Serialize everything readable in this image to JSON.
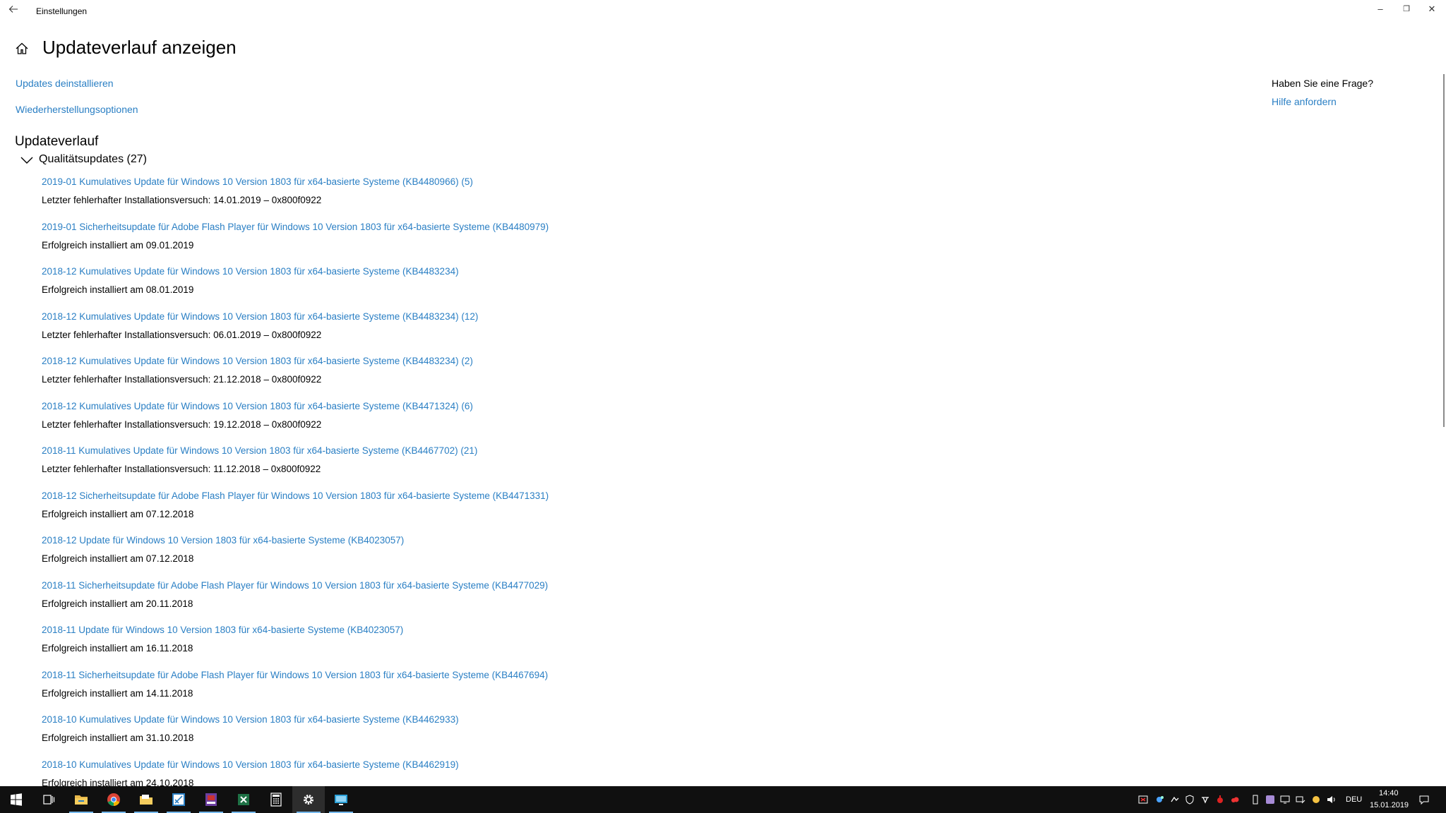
{
  "window": {
    "title": "Einstellungen",
    "minimize_label": "–",
    "restore_label": "❐",
    "close_label": "✕"
  },
  "header": {
    "title": "Updateverlauf anzeigen"
  },
  "links": {
    "uninstall": "Updates deinstallieren",
    "recovery": "Wiederherstellungsoptionen"
  },
  "history": {
    "title": "Updateverlauf",
    "group_label": "Qualitätsupdates (27)",
    "items": [
      {
        "title": "2019-01 Kumulatives Update für Windows 10 Version 1803 für x64-basierte Systeme (KB4480966) (5)",
        "status": "Letzter fehlerhafter Installationsversuch: 14.01.2019 – 0x800f0922"
      },
      {
        "title": "2019-01 Sicherheitsupdate für Adobe Flash Player für Windows 10 Version 1803 für x64-basierte Systeme (KB4480979)",
        "status": "Erfolgreich installiert am 09.01.2019"
      },
      {
        "title": "2018-12 Kumulatives Update für Windows 10 Version 1803 für x64-basierte Systeme (KB4483234)",
        "status": "Erfolgreich installiert am 08.01.2019"
      },
      {
        "title": "2018-12 Kumulatives Update für Windows 10 Version 1803 für x64-basierte Systeme (KB4483234) (12)",
        "status": "Letzter fehlerhafter Installationsversuch: 06.01.2019 – 0x800f0922"
      },
      {
        "title": "2018-12 Kumulatives Update für Windows 10 Version 1803 für x64-basierte Systeme (KB4483234) (2)",
        "status": "Letzter fehlerhafter Installationsversuch: 21.12.2018 – 0x800f0922"
      },
      {
        "title": "2018-12 Kumulatives Update für Windows 10 Version 1803 für x64-basierte Systeme (KB4471324) (6)",
        "status": "Letzter fehlerhafter Installationsversuch: 19.12.2018 – 0x800f0922"
      },
      {
        "title": "2018-11 Kumulatives Update für Windows 10 Version 1803 für x64-basierte Systeme (KB4467702) (21)",
        "status": "Letzter fehlerhafter Installationsversuch: 11.12.2018 – 0x800f0922"
      },
      {
        "title": "2018-12 Sicherheitsupdate für Adobe Flash Player für Windows 10 Version 1803 für x64-basierte Systeme (KB4471331)",
        "status": "Erfolgreich installiert am 07.12.2018"
      },
      {
        "title": "2018-12 Update für Windows 10 Version 1803 für x64-basierte Systeme (KB4023057)",
        "status": "Erfolgreich installiert am 07.12.2018"
      },
      {
        "title": "2018-11 Sicherheitsupdate für Adobe Flash Player für Windows 10 Version 1803 für x64-basierte Systeme (KB4477029)",
        "status": "Erfolgreich installiert am 20.11.2018"
      },
      {
        "title": "2018-11 Update für Windows 10 Version 1803 für x64-basierte Systeme (KB4023057)",
        "status": "Erfolgreich installiert am 16.11.2018"
      },
      {
        "title": "2018-11 Sicherheitsupdate für Adobe Flash Player für Windows 10 Version 1803 für x64-basierte Systeme (KB4467694)",
        "status": "Erfolgreich installiert am 14.11.2018"
      },
      {
        "title": "2018-10 Kumulatives Update für Windows 10 Version 1803 für x64-basierte Systeme (KB4462933)",
        "status": "Erfolgreich installiert am 31.10.2018"
      },
      {
        "title": "2018-10 Kumulatives Update für Windows 10 Version 1803 für x64-basierte Systeme (KB4462919)",
        "status": "Erfolgreich installiert am 24.10.2018"
      }
    ]
  },
  "help": {
    "title": "Haben Sie eine Frage?",
    "link": "Hilfe anfordern"
  },
  "taskbar": {
    "apps": [
      {
        "name": "start-button",
        "icon": "windows-logo-icon"
      },
      {
        "name": "task-view-button",
        "icon": "task-view-icon"
      },
      {
        "name": "file-explorer",
        "icon": "folder-icon",
        "running": true
      },
      {
        "name": "chrome",
        "icon": "chrome-icon",
        "running": true
      },
      {
        "name": "notes-folder",
        "icon": "folder-notes-icon",
        "running": true
      },
      {
        "name": "snipping-tool",
        "icon": "scissors-icon",
        "running": true
      },
      {
        "name": "media-app",
        "icon": "film-icon",
        "running": true
      },
      {
        "name": "spreadsheet-app",
        "icon": "spreadsheet-icon",
        "running": true
      },
      {
        "name": "calculator",
        "icon": "calculator-icon"
      },
      {
        "name": "settings",
        "icon": "gear-icon",
        "running": true,
        "active": true
      },
      {
        "name": "remote-desktop",
        "icon": "monitor-icon",
        "running": true
      }
    ],
    "language": "DEU",
    "time": "14:40",
    "date": "15.01.2019"
  },
  "colors": {
    "link": "#2a7fc4",
    "taskbar": "#101010",
    "taskbar_accent": "#76b9ed"
  }
}
